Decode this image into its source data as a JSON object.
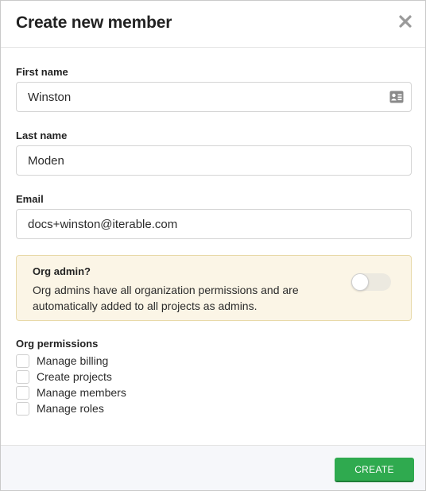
{
  "modal": {
    "title": "Create new member"
  },
  "form": {
    "first_name": {
      "label": "First name",
      "value": "Winston"
    },
    "last_name": {
      "label": "Last name",
      "value": "Moden"
    },
    "email": {
      "label": "Email",
      "value": "docs+winston@iterable.com"
    }
  },
  "org_admin": {
    "title": "Org admin?",
    "description": "Org admins have all organization permissions and are automatically added to all projects as admins.",
    "enabled": false
  },
  "permissions": {
    "header": "Org permissions",
    "items": [
      {
        "label": "Manage billing",
        "checked": false
      },
      {
        "label": "Create projects",
        "checked": false
      },
      {
        "label": "Manage members",
        "checked": false
      },
      {
        "label": "Manage roles",
        "checked": false
      }
    ]
  },
  "footer": {
    "create_label": "CREATE"
  },
  "colors": {
    "primary_button": "#2faa4f",
    "admin_box_bg": "#fbf5e6",
    "footer_bg": "#f6f7fa"
  },
  "icons": {
    "close": "close-icon",
    "contact_card": "contact-card-icon"
  }
}
